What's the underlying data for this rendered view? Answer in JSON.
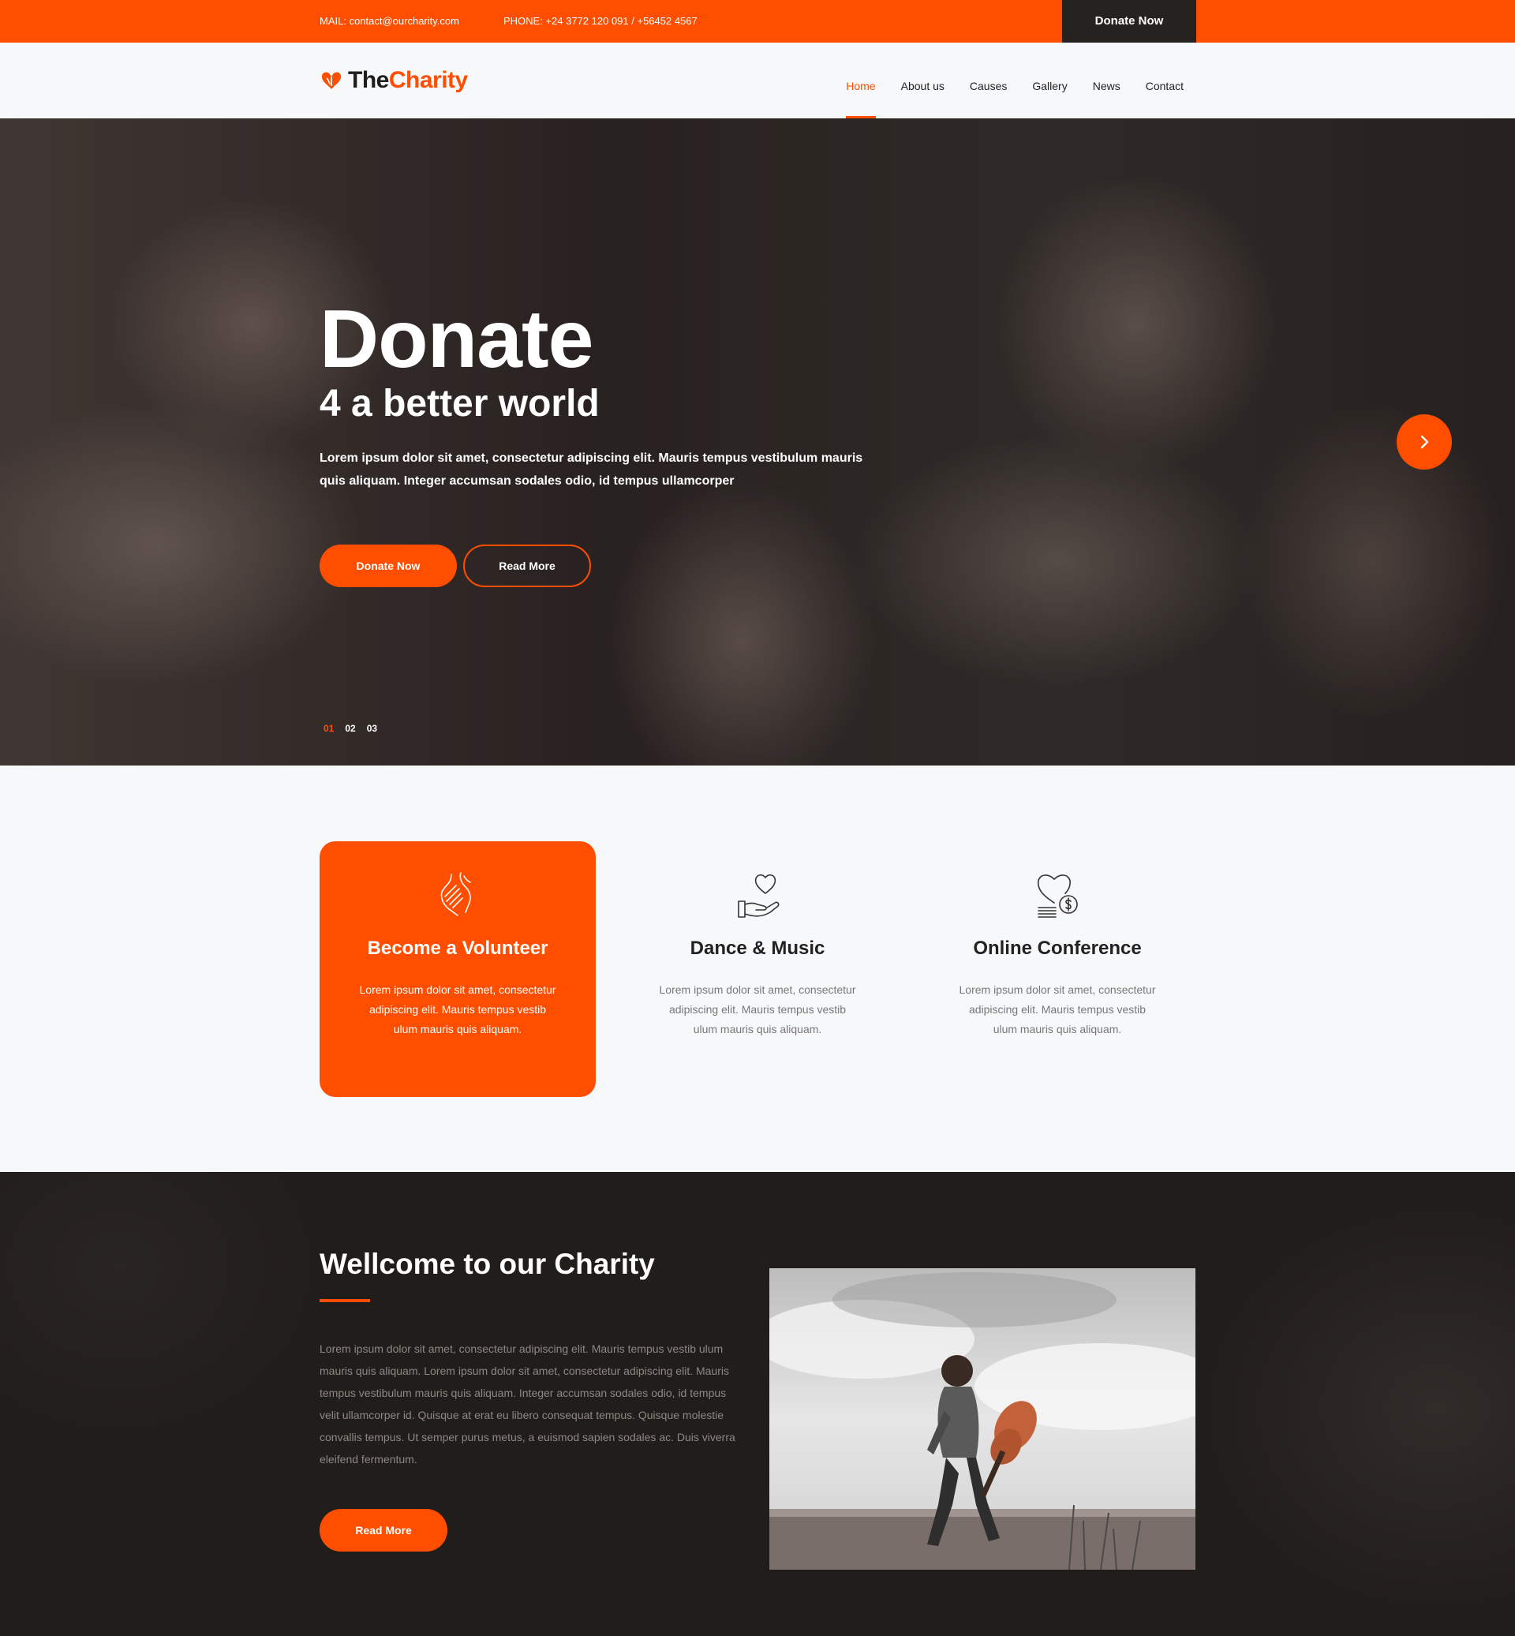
{
  "topbar": {
    "mail": "MAIL: contact@ourcharity.com",
    "phone": "PHONE: +24 3772 120 091 / +56452 4567",
    "donate_label": "Donate Now"
  },
  "logo": {
    "icon": "heart-hands-icon",
    "text_the": "The",
    "text_charity": "Charity"
  },
  "nav": {
    "items": [
      {
        "label": "Home",
        "active": true
      },
      {
        "label": "About us"
      },
      {
        "label": "Causes"
      },
      {
        "label": "Gallery"
      },
      {
        "label": "News"
      },
      {
        "label": "Contact"
      }
    ]
  },
  "hero": {
    "title": "Donate",
    "subtitle": "4 a better world",
    "text": "Lorem ipsum dolor sit amet, consectetur adipiscing elit. Mauris tempus vestibulum mauris quis aliquam. Integer accumsan sodales odio, id tempus ullamcorper",
    "donate_label": "Donate Now",
    "read_label": "Read More",
    "next_icon": "chevron-right-icon",
    "slides": [
      "01",
      "02",
      "03"
    ],
    "active_slide": "01"
  },
  "services": [
    {
      "title": "Become a Volunteer",
      "text": "Lorem ipsum dolor sit amet, consectetur adipiscing elit. Mauris tempus vestib ulum mauris quis aliquam.",
      "icon": "helping-hands-icon",
      "highlighted": true
    },
    {
      "title": "Dance & Music",
      "text": "Lorem ipsum dolor sit amet, consectetur adipiscing elit. Mauris tempus vestib ulum mauris quis aliquam.",
      "icon": "heart-in-hand-icon"
    },
    {
      "title": "Online Conference",
      "text": "Lorem ipsum dolor sit amet, consectetur adipiscing elit. Mauris tempus vestib ulum mauris quis aliquam.",
      "icon": "heart-donation-coins-icon"
    }
  ],
  "welcome": {
    "title": "Wellcome to our Charity",
    "text": "Lorem ipsum dolor sit amet, consectetur adipiscing elit. Mauris tempus vestib ulum mauris quis aliquam. Lorem ipsum dolor sit amet, consectetur adipiscing elit. Mauris tempus vestibulum mauris quis aliquam. Integer accumsan sodales odio, id tempus velit ullamcorper id. Quisque at erat eu libero consequat tempus. Quisque molestie convallis tempus. Ut semper purus metus, a euismod sapien sodales ac. Duis viverra eleifend fermentum.",
    "read_label": "Read More"
  },
  "colors": {
    "accent": "#ff4e00",
    "dark": "#211d1b",
    "topbar_button": "#262220"
  }
}
